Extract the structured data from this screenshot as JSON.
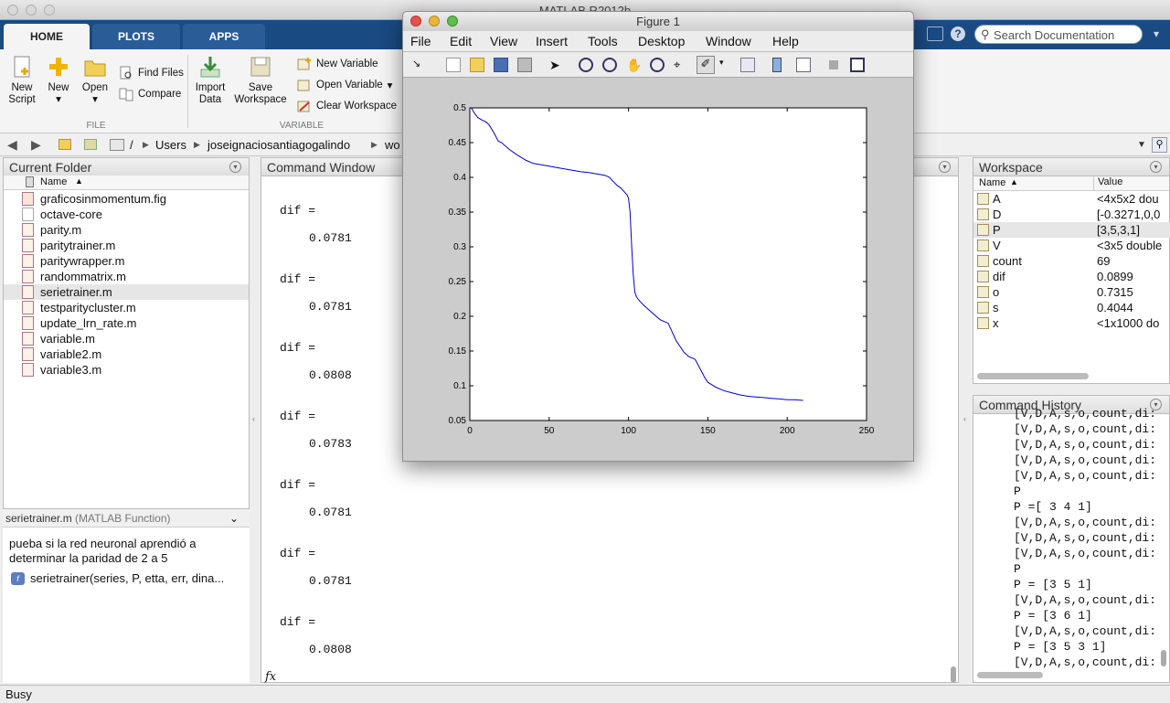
{
  "app_title": "MATLAB R2012b",
  "ribbon": {
    "tabs": [
      "HOME",
      "PLOTS",
      "APPS"
    ],
    "new_script": "New\nScript",
    "new": "New",
    "open": "Open",
    "find_files": "Find Files",
    "compare": "Compare",
    "import_data": "Import\nData",
    "save_workspace": "Save\nWorkspace",
    "new_variable": "New Variable",
    "open_variable": "Open Variable",
    "clear_workspace": "Clear Workspace",
    "group_file": "FILE",
    "group_variable": "VARIABLE",
    "search_placeholder": "Search Documentation"
  },
  "address": {
    "parts": [
      "/",
      "Users",
      "joseignaciosantiagogalindo",
      "wo"
    ]
  },
  "current_folder": {
    "title": "Current Folder",
    "col_name": "Name",
    "files": [
      {
        "name": "graficosinmomentum.fig",
        "type": "fig"
      },
      {
        "name": "octave-core",
        "type": "file"
      },
      {
        "name": "parity.m",
        "type": "m"
      },
      {
        "name": "paritytrainer.m",
        "type": "m"
      },
      {
        "name": "paritywrapper.m",
        "type": "m"
      },
      {
        "name": "randommatrix.m",
        "type": "m"
      },
      {
        "name": "serietrainer.m",
        "type": "m",
        "selected": true
      },
      {
        "name": "testparitycluster.m",
        "type": "m"
      },
      {
        "name": "update_lrn_rate.m",
        "type": "m"
      },
      {
        "name": "variable.m",
        "type": "m"
      },
      {
        "name": "variable2.m",
        "type": "m"
      },
      {
        "name": "variable3.m",
        "type": "m"
      }
    ],
    "details_title": "serietrainer.m",
    "details_kind": "(MATLAB Function)",
    "details_desc": "pueba si la red neuronal aprendió a determinar la paridad de 2 a 5",
    "details_sig": "serietrainer(series, P, etta, err, dina..."
  },
  "command_window": {
    "title": "Command Window",
    "entries": [
      {
        "label": "dif =",
        "value": "0.0781"
      },
      {
        "label": "dif =",
        "value": "0.0781"
      },
      {
        "label": "dif =",
        "value": "0.0808"
      },
      {
        "label": "dif =",
        "value": "0.0783"
      },
      {
        "label": "dif =",
        "value": "0.0781"
      },
      {
        "label": "dif =",
        "value": "0.0781"
      },
      {
        "label": "dif =",
        "value": "0.0808"
      }
    ],
    "prompt": "fx"
  },
  "workspace": {
    "title": "Workspace",
    "col_name": "Name",
    "col_value": "Value",
    "vars": [
      {
        "name": "A",
        "value": "<4x5x2 dou"
      },
      {
        "name": "D",
        "value": "[-0.3271,0,0"
      },
      {
        "name": "P",
        "value": "[3,5,3,1]",
        "selected": true
      },
      {
        "name": "V",
        "value": "<3x5 double"
      },
      {
        "name": "count",
        "value": "69"
      },
      {
        "name": "dif",
        "value": "0.0899"
      },
      {
        "name": "o",
        "value": "0.7315"
      },
      {
        "name": "s",
        "value": "0.4044"
      },
      {
        "name": "x",
        "value": "<1x1000 do"
      }
    ]
  },
  "command_history": {
    "title": "Command History",
    "lines": [
      "[V,D,A,s,o,count,di:",
      "[V,D,A,s,o,count,di:",
      "[V,D,A,s,o,count,di:",
      "[V,D,A,s,o,count,di:",
      "[V,D,A,s,o,count,di:",
      "P",
      "P =[ 3 4 1]",
      "[V,D,A,s,o,count,di:",
      "[V,D,A,s,o,count,di:",
      "[V,D,A,s,o,count,di:",
      "P",
      "P = [3 5 1]",
      "[V,D,A,s,o,count,di:",
      "P = [3 6 1]",
      "[V,D,A,s,o,count,di:",
      "P = [3 5 3 1]",
      "[V,D,A,s,o,count,di:"
    ]
  },
  "status": "Busy",
  "figure": {
    "title": "Figure 1",
    "menu": [
      "File",
      "Edit",
      "View",
      "Insert",
      "Tools",
      "Desktop",
      "Window",
      "Help"
    ]
  },
  "chart_data": {
    "type": "line",
    "title": "",
    "xlabel": "",
    "ylabel": "",
    "xlim": [
      0,
      250
    ],
    "ylim": [
      0.05,
      0.5
    ],
    "xticks": [
      0,
      50,
      100,
      150,
      200,
      250
    ],
    "yticks": [
      0.05,
      0.1,
      0.15,
      0.2,
      0.25,
      0.3,
      0.35,
      0.4,
      0.45,
      0.5
    ],
    "grid": false,
    "color": "#0000cc",
    "series": [
      {
        "x": [
          1,
          3,
          5,
          8,
          10,
          12,
          15,
          18,
          20,
          25,
          30,
          35,
          40,
          45,
          50,
          55,
          60,
          65,
          70,
          75,
          80,
          85,
          88,
          90,
          93,
          95,
          97,
          99,
          100,
          101,
          102,
          103,
          104,
          105,
          106,
          107,
          110,
          115,
          120,
          125,
          130,
          135,
          138,
          140,
          142,
          145,
          148,
          150,
          155,
          160,
          165,
          170,
          175,
          180,
          185,
          190,
          195,
          200,
          205,
          210
        ],
        "y": [
          0.5,
          0.492,
          0.486,
          0.482,
          0.48,
          0.476,
          0.465,
          0.452,
          0.45,
          0.44,
          0.432,
          0.425,
          0.42,
          0.418,
          0.416,
          0.414,
          0.412,
          0.41,
          0.408,
          0.407,
          0.405,
          0.403,
          0.4,
          0.395,
          0.388,
          0.385,
          0.38,
          0.375,
          0.37,
          0.35,
          0.3,
          0.26,
          0.235,
          0.228,
          0.225,
          0.222,
          0.215,
          0.205,
          0.195,
          0.19,
          0.165,
          0.148,
          0.142,
          0.14,
          0.138,
          0.125,
          0.112,
          0.105,
          0.098,
          0.093,
          0.09,
          0.087,
          0.085,
          0.084,
          0.083,
          0.082,
          0.081,
          0.08,
          0.08,
          0.079
        ]
      }
    ]
  }
}
